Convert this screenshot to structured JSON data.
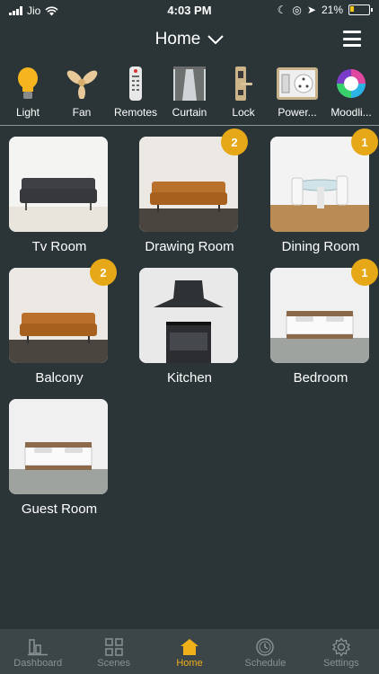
{
  "status": {
    "carrier": "Jio",
    "time": "4:03 PM",
    "battery": "21%"
  },
  "header": {
    "title": "Home"
  },
  "categories": [
    {
      "label": "Light",
      "icon": "bulb-icon"
    },
    {
      "label": "Fan",
      "icon": "fan-icon"
    },
    {
      "label": "Remotes",
      "icon": "remote-icon"
    },
    {
      "label": "Curtain",
      "icon": "curtain-icon"
    },
    {
      "label": "Lock",
      "icon": "lock-icon"
    },
    {
      "label": "Power...",
      "icon": "power-socket-icon"
    },
    {
      "label": "Moodli...",
      "icon": "mood-light-icon"
    }
  ],
  "rooms": [
    {
      "name": "Tv Room",
      "badge": ""
    },
    {
      "name": "Drawing Room",
      "badge": "2"
    },
    {
      "name": "Dining Room",
      "badge": "1"
    },
    {
      "name": "Balcony",
      "badge": "2"
    },
    {
      "name": "Kitchen",
      "badge": ""
    },
    {
      "name": "Bedroom",
      "badge": "1"
    },
    {
      "name": "Guest Room",
      "badge": ""
    }
  ],
  "nav": [
    {
      "label": "Dashboard"
    },
    {
      "label": "Scenes"
    },
    {
      "label": "Home"
    },
    {
      "label": "Schedule"
    },
    {
      "label": "Settings"
    }
  ],
  "colors": {
    "background": "#2b3537",
    "accent": "#f0b01a",
    "badge": "#e6a817"
  }
}
